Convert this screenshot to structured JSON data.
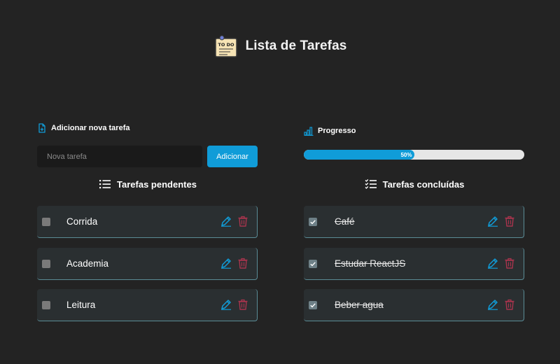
{
  "header": {
    "title": "Lista de Tarefas",
    "logo_text": "TO DO"
  },
  "add_task": {
    "label": "Adicionar nova tarefa",
    "placeholder": "Nova tarefa",
    "value": "",
    "button_label": "Adicionar"
  },
  "progress": {
    "label": "Progresso",
    "percent": 50,
    "percent_text": "50%"
  },
  "pending": {
    "heading": "Tarefas pendentes",
    "tasks": [
      {
        "text": "Corrida",
        "done": false
      },
      {
        "text": "Academia",
        "done": false
      },
      {
        "text": "Leitura",
        "done": false
      }
    ]
  },
  "completed": {
    "heading": "Tarefas concluídas",
    "tasks": [
      {
        "text": "Café",
        "done": true
      },
      {
        "text": "Estudar ReactJS",
        "done": true
      },
      {
        "text": "Beber agua",
        "done": true
      }
    ]
  },
  "icons": {
    "edit": "pencil-icon",
    "delete": "trash-icon",
    "add": "file-plus-icon",
    "progress": "bar-chart-icon",
    "pending": "list-icon",
    "completed": "checklist-icon"
  },
  "colors": {
    "background": "#232323",
    "accent": "#109cd8",
    "delete": "#a8344d",
    "card": "#2a2f31"
  }
}
